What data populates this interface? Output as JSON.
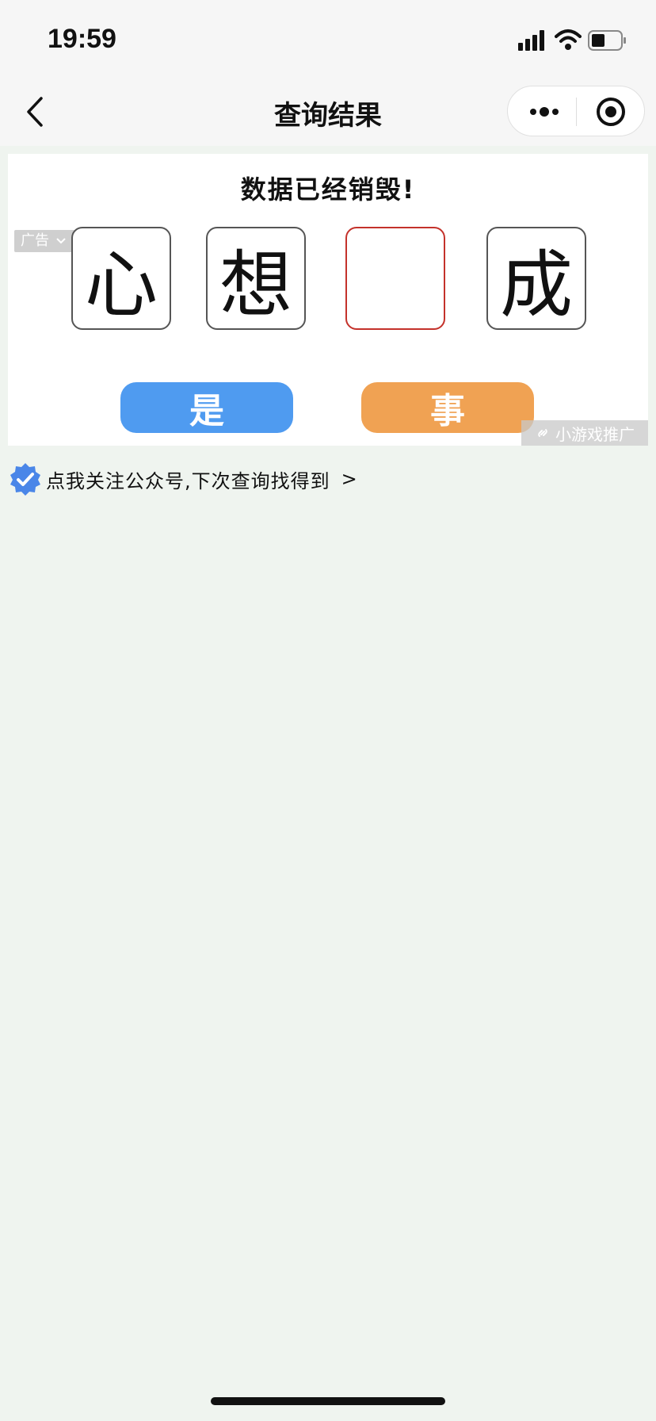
{
  "status_bar": {
    "time": "19:59",
    "icons": [
      "signal-icon",
      "wifi-icon",
      "battery-icon"
    ]
  },
  "nav": {
    "title": "查询结果",
    "back_icon": "chevron-left-icon",
    "capsule_icons": [
      "more-icon",
      "target-icon"
    ]
  },
  "puzzle": {
    "title": "数据已经销毁!",
    "ad_label": "广告",
    "tiles": [
      "心",
      "想",
      "",
      "成"
    ],
    "options": [
      "是",
      "事"
    ],
    "promo_tag": "小游戏推广"
  },
  "follow": {
    "text": "点我关注公众号,下次查询找得到",
    "arrow": ">"
  },
  "colors": {
    "background": "#eff4ef",
    "blue_button": "#4f9bf0",
    "orange_button": "#f0a253",
    "empty_tile_border": "#c4322b"
  }
}
